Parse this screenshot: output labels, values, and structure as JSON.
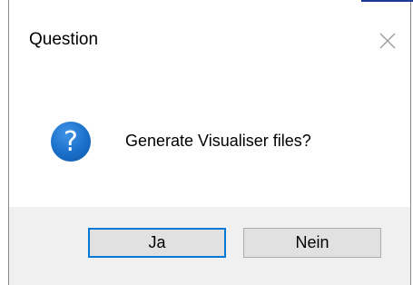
{
  "dialog": {
    "title": "Question",
    "close_icon": "close-icon",
    "icon": "question-mark-icon",
    "icon_glyph": "?",
    "message": "Generate Visualiser files?",
    "buttons": {
      "yes_label": "Ja",
      "no_label": "Nein"
    }
  },
  "colors": {
    "accent": "#0078d7",
    "icon_blue": "#1a6fc9",
    "footer_bg": "#f0f0f0",
    "button_bg": "#e1e1e1"
  }
}
